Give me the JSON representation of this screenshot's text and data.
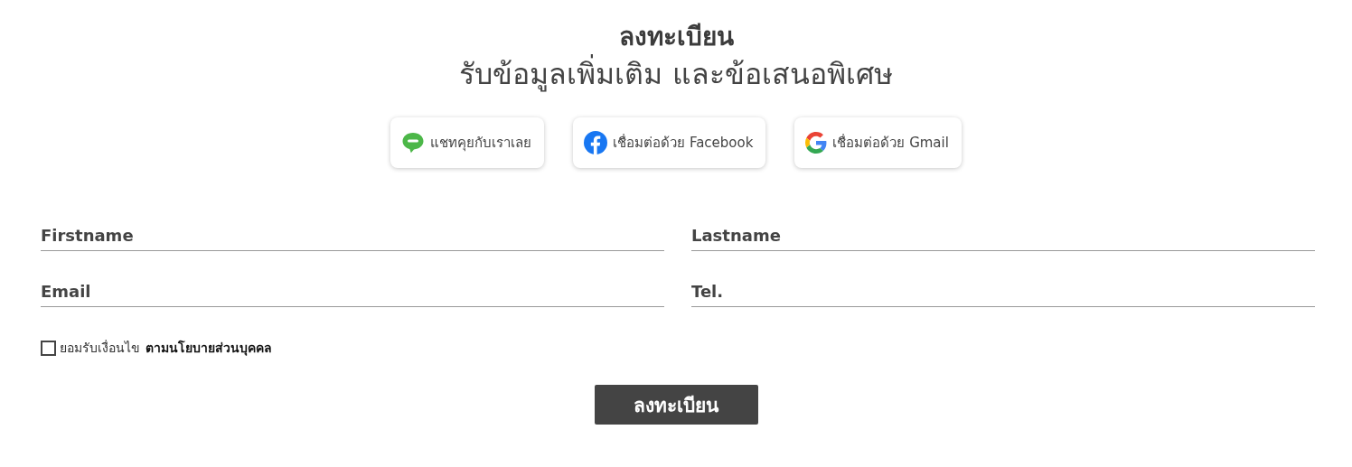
{
  "title": "ลงทะเบียน",
  "subtitle": "รับข้อมูลเพิ่มเติม และข้อเสนอพิเศษ",
  "social_buttons": [
    {
      "kind": "line",
      "label": "แชทคุยกับเราเลย"
    },
    {
      "kind": "facebook",
      "label": "เชื่อมต่อด้วย Facebook"
    },
    {
      "kind": "google",
      "label": "เชื่อมต่อด้วย Gmail"
    }
  ],
  "fields": [
    {
      "placeholder": "Firstname"
    },
    {
      "placeholder": "Lastname"
    },
    {
      "placeholder": "Email"
    },
    {
      "placeholder": "Tel."
    }
  ],
  "consent": {
    "checked": false,
    "text": "ยอมรับเงื่อนไข",
    "link": "ตามนโยบายส่วนบุคคล"
  },
  "submit": "ลงทะเบียน"
}
